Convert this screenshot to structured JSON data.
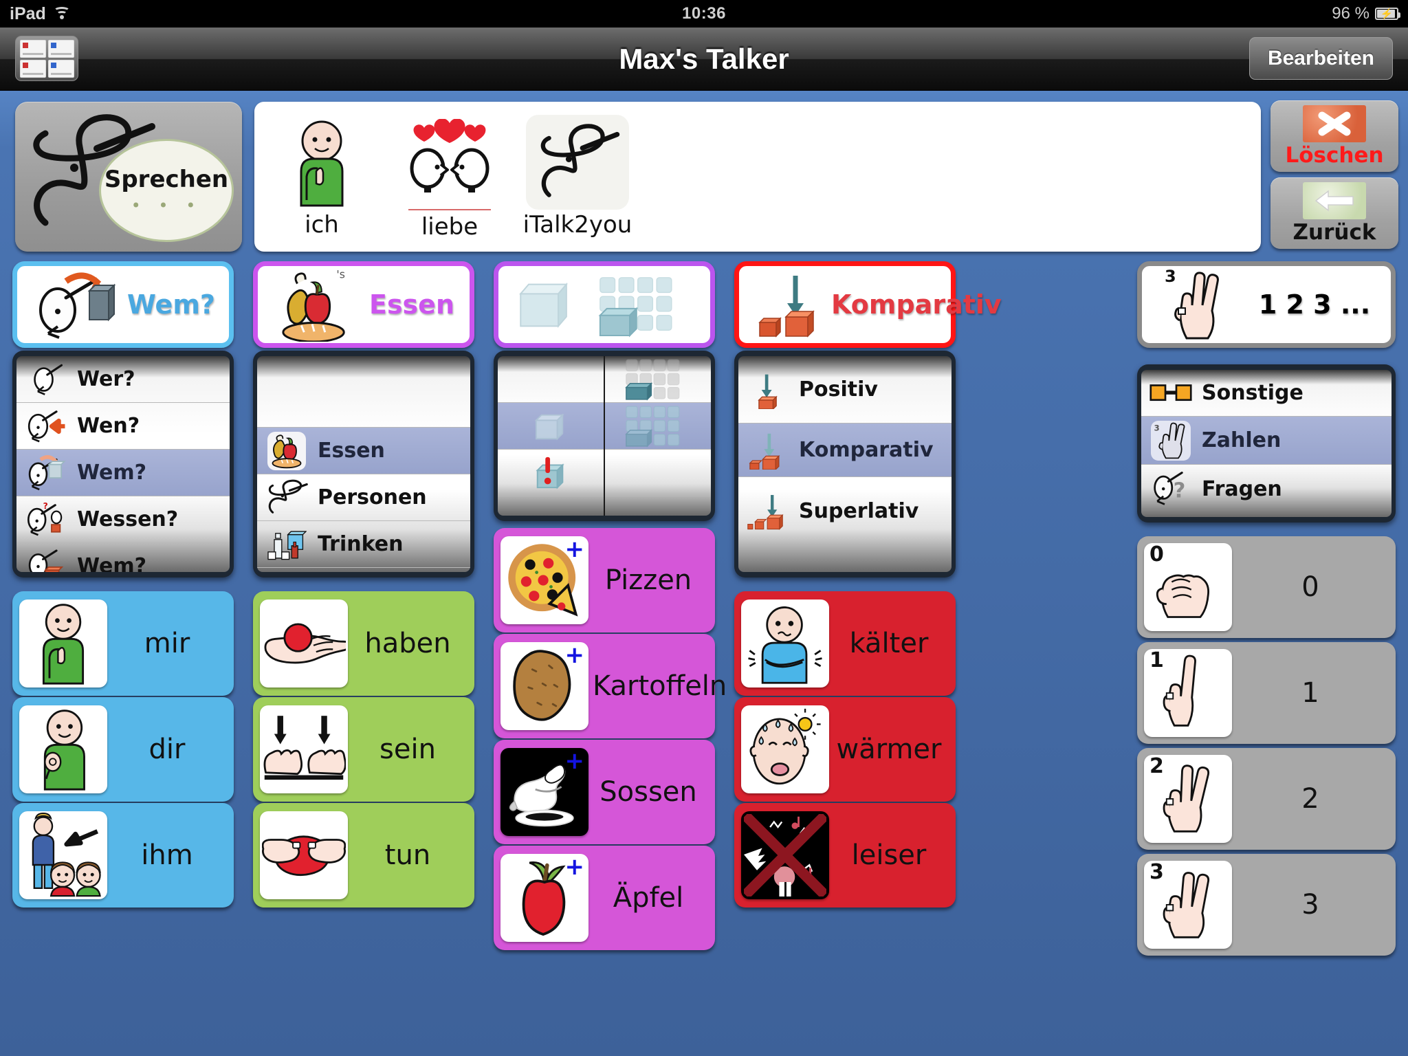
{
  "status_bar": {
    "device": "iPad",
    "wifi_icon": "wifi-icon",
    "time": "10:36",
    "battery_percent": "96 %",
    "battery_icon": "battery-charging-icon"
  },
  "nav_bar": {
    "grid_button_icon": "grid-pages-icon",
    "title": "Max's Talker",
    "edit_label": "Bearbeiten"
  },
  "speak_button": {
    "label": "Sprechen",
    "dots": "• • •",
    "icon": "italk2you-logo-icon"
  },
  "sentence_bar": {
    "items": [
      {
        "label": "ich",
        "icon": "person-pointing-self-icon",
        "underline": false
      },
      {
        "label": "liebe",
        "icon": "two-faces-hearts-icon",
        "underline": true
      },
      {
        "label": "iTalk2you",
        "icon": "italk2you-logo-icon",
        "underline": false
      }
    ]
  },
  "controls": {
    "delete": {
      "label": "Löschen",
      "icon": "white-x-on-orange-icon",
      "color": "#ff1a1a"
    },
    "back": {
      "label": "Zurück",
      "icon": "left-arrow-on-green-icon",
      "color": "#111111"
    }
  },
  "categories": [
    {
      "label": "Wem?",
      "icon": "head-arrow-to-box-icon",
      "border": "#5bc0f0",
      "text_color": "#4aa8e0"
    },
    {
      "label": "Essen",
      "icon": "food-chicken-apple-bread-icon",
      "border": "#cc55ee",
      "text_color": "#cc55ee"
    },
    {
      "label": "",
      "icon": "ice-cubes-singular-plural-icon",
      "border": "#bb55ee",
      "text_color": "#111111"
    },
    {
      "label": "Komparativ",
      "icon": "arrow-down-two-red-cubes-icon",
      "border": "#ff1515",
      "text_color": "#e33a42"
    },
    {
      "label": "1 2 3 ...",
      "icon": "hand-three-fingers-icon",
      "border": "#8a8a8a",
      "text_color": "#111111"
    }
  ],
  "pickers": [
    {
      "name": "case-picker",
      "rows": [
        {
          "label": "Wer?",
          "icon": "head-icon",
          "selected": false
        },
        {
          "label": "Wen?",
          "icon": "head-red-arrow-icon",
          "selected": false
        },
        {
          "label": "Wem?",
          "icon": "head-arrow-box-icon",
          "selected": true
        },
        {
          "label": "Wessen?",
          "icon": "head-question-box-icon",
          "selected": false
        },
        {
          "label": "Wem?",
          "icon": "head-red-box-icon",
          "selected": false
        }
      ]
    },
    {
      "name": "category-picker",
      "rows": [
        {
          "label": "",
          "icon": "",
          "selected": false
        },
        {
          "label": "Essen",
          "icon": "food-plate-icon",
          "selected": true
        },
        {
          "label": "Personen",
          "icon": "italk2you-logo-icon",
          "selected": false
        },
        {
          "label": "Trinken",
          "icon": "drinks-bottles-icon",
          "selected": false
        }
      ]
    },
    {
      "name": "number-form-picker",
      "columns": [
        {
          "rows": [
            {
              "icon": "",
              "selected": false
            },
            {
              "icon": "ice-cube-single-icon",
              "selected": true
            },
            {
              "icon": "ice-cube-exclamation-icon",
              "selected": false
            }
          ]
        },
        {
          "rows": [
            {
              "icon": "ice-cubes-many-icon",
              "selected": false
            },
            {
              "icon": "ice-cubes-many-icon",
              "selected": true
            },
            {
              "icon": "",
              "selected": false
            }
          ]
        }
      ]
    },
    {
      "name": "comparison-picker",
      "rows": [
        {
          "label": "Positiv",
          "icon": "arrow-one-cube-icon",
          "selected": false
        },
        {
          "label": "Komparativ",
          "icon": "arrow-two-cubes-icon",
          "selected": true
        },
        {
          "label": "Superlativ",
          "icon": "arrow-three-cubes-icon",
          "selected": false
        }
      ]
    },
    {
      "name": "topic-picker",
      "rows": [
        {
          "label": "Sonstige",
          "icon": "two-orange-squares-icon",
          "selected": false
        },
        {
          "label": "Zahlen",
          "icon": "hand-three-fingers-icon",
          "selected": true
        },
        {
          "label": "Fragen",
          "icon": "head-question-mark-icon",
          "selected": false
        }
      ]
    }
  ],
  "grid_columns": [
    {
      "name": "pronouns-column",
      "color": "#57b7e8",
      "cells": [
        {
          "label": "mir",
          "icon": "person-pointing-self-icon",
          "plus": false
        },
        {
          "label": "dir",
          "icon": "person-pointing-you-icon",
          "plus": false
        },
        {
          "label": "ihm",
          "icon": "person-arrow-group-icon",
          "plus": false
        }
      ]
    },
    {
      "name": "verbs-column",
      "color": "#9fce5a",
      "cells": [
        {
          "label": "haben",
          "icon": "hand-holding-ball-icon",
          "plus": false
        },
        {
          "label": "sein",
          "icon": "two-hands-arrows-icon",
          "plus": false
        },
        {
          "label": "tun",
          "icon": "hands-squeezing-ball-icon",
          "plus": false
        }
      ]
    },
    {
      "name": "food-column",
      "color": "#d556d8",
      "cells": [
        {
          "label": "Pizzen",
          "icon": "pizza-icon",
          "plus": true
        },
        {
          "label": "Kartoffeln",
          "icon": "potato-icon",
          "plus": true
        },
        {
          "label": "Sossen",
          "icon": "gravy-boat-icon",
          "plus": true,
          "dark": true
        },
        {
          "label": "Äpfel",
          "icon": "apple-icon",
          "plus": true
        }
      ]
    },
    {
      "name": "adjectives-column",
      "color": "#d8212e",
      "cells": [
        {
          "label": "kälter",
          "icon": "cold-person-shivering-icon",
          "plus": false
        },
        {
          "label": "wärmer",
          "icon": "hot-person-sweating-icon",
          "plus": false
        },
        {
          "label": "leiser",
          "icon": "no-loud-noise-icon",
          "plus": false,
          "dark": true
        }
      ]
    },
    {
      "name": "numbers-column",
      "color": "#a8a8a8",
      "cells": [
        {
          "label": "0",
          "badge": "0",
          "icon": "hand-fist-icon",
          "plus": false
        },
        {
          "label": "1",
          "badge": "1",
          "icon": "hand-one-finger-icon",
          "plus": false
        },
        {
          "label": "2",
          "badge": "2",
          "icon": "hand-two-fingers-icon",
          "plus": false
        },
        {
          "label": "3",
          "badge": "3",
          "icon": "hand-three-fingers-icon",
          "plus": false
        }
      ]
    }
  ]
}
